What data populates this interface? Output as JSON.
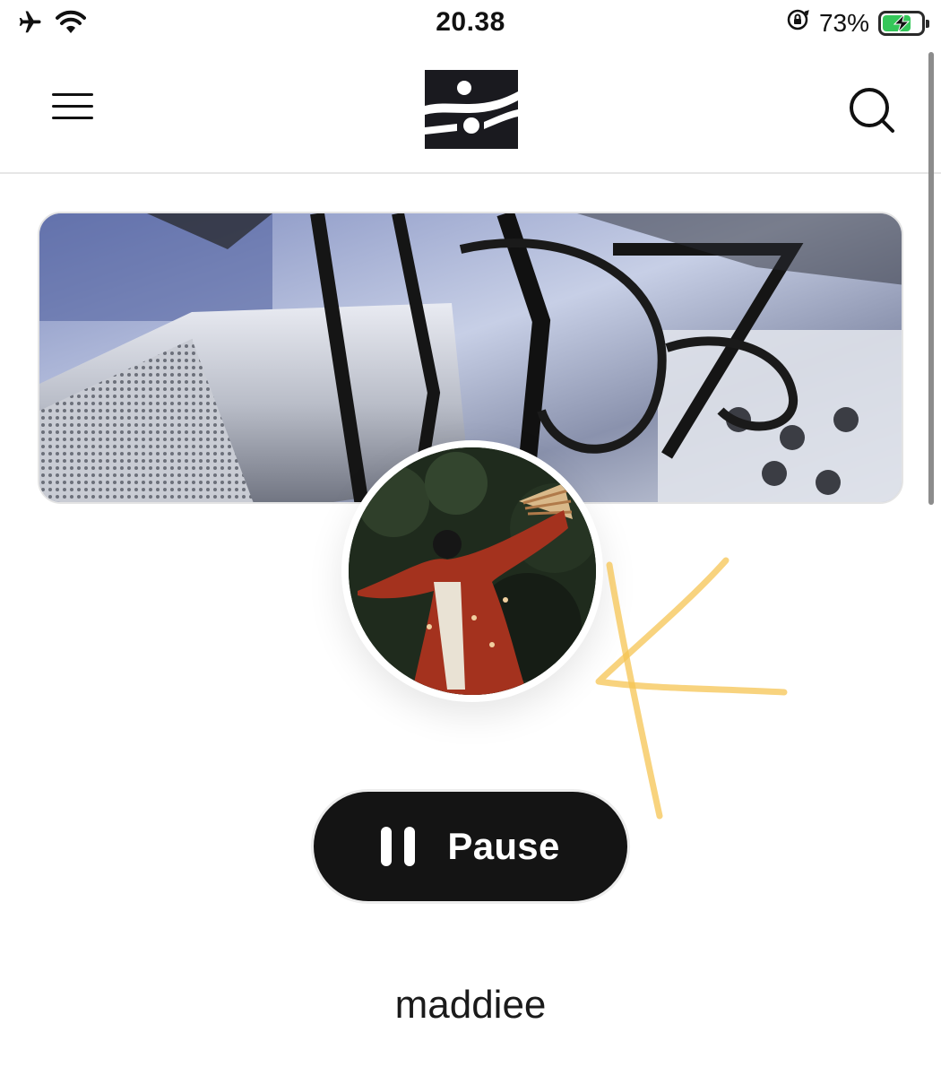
{
  "status_bar": {
    "time": "20.38",
    "battery_percent": "73%",
    "battery_level": 0.73,
    "icons": [
      "airplane-icon",
      "wifi-icon",
      "orientation-lock-icon",
      "battery-charging-icon"
    ]
  },
  "header": {
    "menu_icon": "hamburger-menu-icon",
    "logo_icon": "app-logo",
    "search_icon": "search-icon"
  },
  "profile": {
    "cover_image": "microphone-photo",
    "avatar_image": "kimono-dancer-photo",
    "username": "maddiee"
  },
  "player": {
    "action_label": "Pause",
    "action_icon": "pause-icon"
  },
  "colors": {
    "button_bg": "#141414",
    "battery_green": "#34c759",
    "scribble": "#f6c453"
  }
}
